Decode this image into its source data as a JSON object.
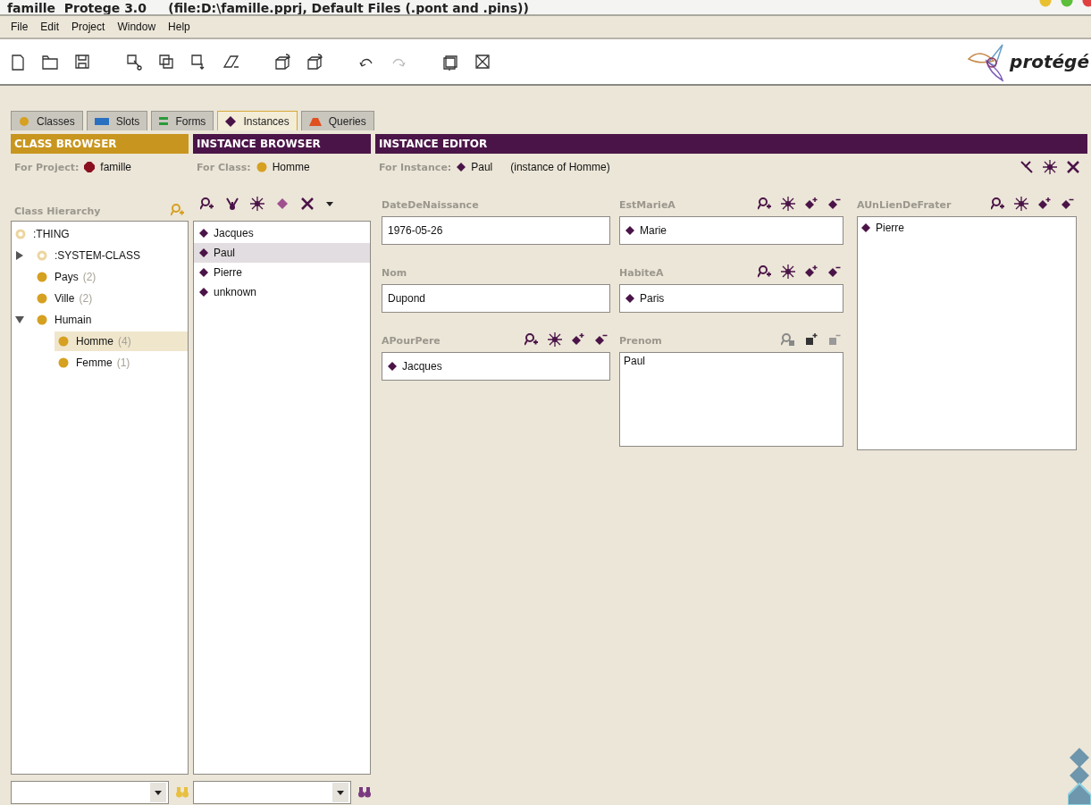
{
  "window": {
    "title": "famille  Protege 3.0     (file:D:\\famille.pprj, Default Files (.pont and .pins))"
  },
  "menu": [
    "File",
    "Edit",
    "Project",
    "Window",
    "Help"
  ],
  "logo": "protégé",
  "tabs": [
    {
      "label": "Classes",
      "kind": "classes",
      "selected": false
    },
    {
      "label": "Slots",
      "kind": "slots",
      "selected": false
    },
    {
      "label": "Forms",
      "kind": "forms",
      "selected": false
    },
    {
      "label": "Instances",
      "kind": "instances",
      "selected": true
    },
    {
      "label": "Queries",
      "kind": "queries",
      "selected": false
    }
  ],
  "class_browser": {
    "header": "CLASS BROWSER",
    "for_label": "For Project:",
    "project": "famille",
    "hierarchy_label": "Class Hierarchy",
    "tree": [
      {
        "label": ":THING",
        "kind": "system",
        "selected": false,
        "children": [
          {
            "label": ":SYSTEM-CLASS",
            "kind": "system",
            "selected": false,
            "expanded": false
          },
          {
            "label": "Pays",
            "count": "(2)",
            "kind": "class",
            "selected": false
          },
          {
            "label": "Ville",
            "count": "(2)",
            "kind": "class",
            "selected": false
          },
          {
            "label": "Humain",
            "kind": "class",
            "selected": false,
            "expanded": true,
            "children": [
              {
                "label": "Homme",
                "count": "(4)",
                "kind": "class",
                "selected": true
              },
              {
                "label": "Femme",
                "count": "(1)",
                "kind": "class",
                "selected": false
              }
            ]
          }
        ]
      }
    ]
  },
  "instance_browser": {
    "header": "INSTANCE BROWSER",
    "for_label": "For Class:",
    "class": "Homme",
    "instances": [
      {
        "label": "Jacques",
        "selected": false
      },
      {
        "label": "Paul",
        "selected": true
      },
      {
        "label": "Pierre",
        "selected": false
      },
      {
        "label": "unknown",
        "selected": false
      }
    ]
  },
  "instance_editor": {
    "header": "INSTANCE EDITOR",
    "for_label": "For Instance:",
    "instance": "Paul",
    "instance_of": "(instance of Homme)",
    "columns": [
      [
        {
          "name": "DateDeNaissance",
          "kind": "text",
          "value": "1976-05-26"
        },
        {
          "name": "Nom",
          "kind": "text",
          "value": "Dupond"
        },
        {
          "name": "APourPere",
          "kind": "instance",
          "value": "Jacques"
        }
      ],
      [
        {
          "name": "EstMarieA",
          "kind": "instance",
          "value": "Marie"
        },
        {
          "name": "HabiteA",
          "kind": "instance",
          "value": "Paris"
        },
        {
          "name": "Prenom",
          "kind": "textlist",
          "values": [
            "Paul"
          ]
        }
      ],
      [
        {
          "name": "AUnLienDeFrater",
          "kind": "instancelist",
          "values": [
            "Pierre"
          ]
        }
      ]
    ]
  }
}
